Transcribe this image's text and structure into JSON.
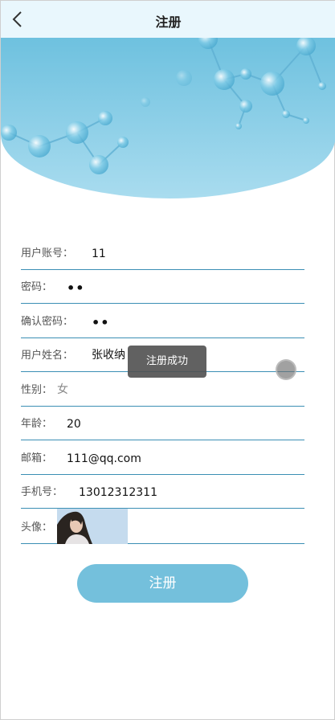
{
  "header": {
    "title": "注册",
    "back_icon": "chevron-left-icon"
  },
  "form": {
    "account_label": "用户账号：",
    "account_value": "11",
    "password_label": "密码：",
    "password_value": "••",
    "confirm_label": "确认密码：",
    "confirm_value": "••",
    "name_label": "用户姓名：",
    "name_value": "张收纳",
    "gender_label": "性别：",
    "gender_value": "女",
    "age_label": "年龄：",
    "age_value": "20",
    "email_label": "邮箱：",
    "email_value": "111@qq.com",
    "phone_label": "手机号：",
    "phone_value": "13012312311",
    "avatar_label": "头像："
  },
  "submit_label": "注册",
  "toast_text": "注册成功",
  "colors": {
    "header_bg": "#e9f7fd",
    "accent": "#74c0dc",
    "divider": "#3b8fb4"
  }
}
